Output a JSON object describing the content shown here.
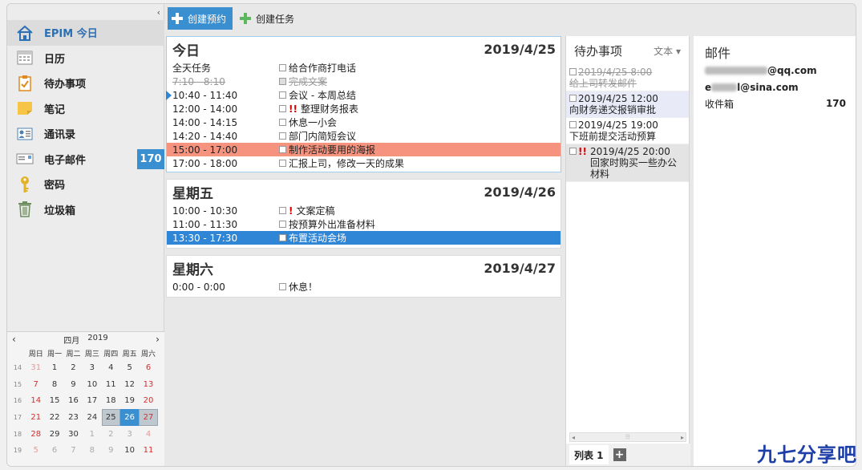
{
  "sidebar": {
    "items": [
      {
        "label": "EPIM 今日",
        "icon": "home-icon",
        "active": true
      },
      {
        "label": "日历",
        "icon": "calendar-icon"
      },
      {
        "label": "待办事项",
        "icon": "todo-icon"
      },
      {
        "label": "笔记",
        "icon": "note-icon"
      },
      {
        "label": "通讯录",
        "icon": "contacts-icon"
      },
      {
        "label": "电子邮件",
        "icon": "mail-icon",
        "badge": "170"
      },
      {
        "label": "密码",
        "icon": "key-icon"
      },
      {
        "label": "垃圾箱",
        "icon": "trash-icon"
      }
    ]
  },
  "minical": {
    "month": "四月",
    "year": "2019",
    "dow": [
      "周日",
      "周一",
      "周二",
      "周三",
      "周四",
      "周五",
      "周六"
    ],
    "weeks": [
      {
        "wk": "14",
        "days": [
          "31",
          "1",
          "2",
          "3",
          "4",
          "5",
          "6"
        ]
      },
      {
        "wk": "15",
        "days": [
          "7",
          "8",
          "9",
          "10",
          "11",
          "12",
          "13"
        ]
      },
      {
        "wk": "16",
        "days": [
          "14",
          "15",
          "16",
          "17",
          "18",
          "19",
          "20"
        ]
      },
      {
        "wk": "17",
        "days": [
          "21",
          "22",
          "23",
          "24",
          "25",
          "26",
          "27"
        ]
      },
      {
        "wk": "18",
        "days": [
          "28",
          "29",
          "30",
          "1",
          "2",
          "3",
          "4"
        ]
      },
      {
        "wk": "19",
        "days": [
          "5",
          "6",
          "7",
          "8",
          "9",
          "10",
          "11"
        ]
      }
    ]
  },
  "toolbar": {
    "new_appointment": "创建预约",
    "new_task": "创建任务"
  },
  "days": [
    {
      "name": "今日",
      "date": "2019/4/25",
      "rows": [
        {
          "time": "全天任务",
          "title": "给合作商打电话",
          "chk": true
        },
        {
          "time": "7:10 - 8:10",
          "title": "完成文案",
          "chk": true,
          "done": true
        },
        {
          "time": "10:40 - 11:40",
          "title": "会议 - 本周总结",
          "chk": true,
          "current": true
        },
        {
          "time": "12:00 - 14:00",
          "title": "整理财务报表",
          "chk": true,
          "pri": "!!"
        },
        {
          "time": "14:00 - 14:15",
          "title": "休息一小会",
          "chk": true
        },
        {
          "time": "14:20 - 14:40",
          "title": "部门内简短会议",
          "chk": true
        },
        {
          "time": "15:00 - 17:00",
          "title": "制作活动要用的海报",
          "chk": true,
          "hl": "red"
        },
        {
          "time": "17:00 - 18:00",
          "title": "汇报上司，修改一天的成果",
          "chk": true
        }
      ]
    },
    {
      "name": "星期五",
      "date": "2019/4/26",
      "rows": [
        {
          "time": "10:00 - 10:30",
          "title": "文案定稿",
          "chk": true,
          "pri": "!"
        },
        {
          "time": "11:00 - 11:30",
          "title": "按预算外出准备材料",
          "chk": true
        },
        {
          "time": "13:30 - 17:30",
          "title": "布置活动会场",
          "chk": true,
          "hl": "blue"
        }
      ]
    },
    {
      "name": "星期六",
      "date": "2019/4/27",
      "rows": [
        {
          "time": "0:00 - 0:00",
          "title": "休息！",
          "chk": true
        }
      ]
    }
  ],
  "todo": {
    "title": "待办事项",
    "mode": "文本",
    "items": [
      {
        "when": "2019/4/25 8:00",
        "desc": "给上司转发邮件",
        "done": true
      },
      {
        "when": "2019/4/25 12:00",
        "desc": "向财务递交报销审批",
        "style": "blue"
      },
      {
        "when": "2019/4/25 19:00",
        "desc": "下班前提交活动预算"
      },
      {
        "when": "2019/4/25 20:00",
        "desc": "回家时购买一些办公材料",
        "pri": "!!",
        "style": "gray"
      }
    ],
    "tab_label": "列表 1",
    "add_tab": "+"
  },
  "mail": {
    "title": "邮件",
    "accounts": [
      {
        "suffix": "@qq.com"
      },
      {
        "prefix": "e",
        "suffix": "l@sina.com"
      }
    ],
    "folder_label": "收件箱",
    "folder_count": "170"
  },
  "brand": "九七分享吧"
}
